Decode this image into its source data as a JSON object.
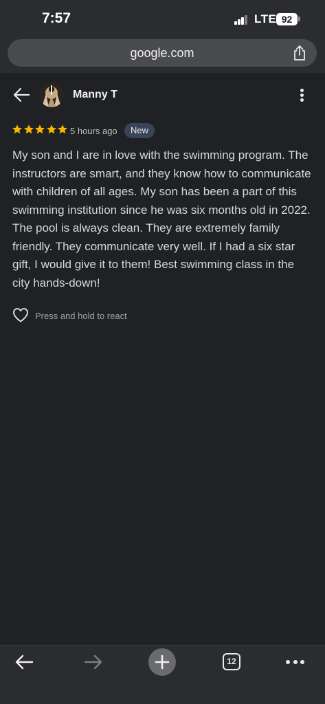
{
  "status_bar": {
    "time": "7:57",
    "network": "LTE",
    "battery": "92"
  },
  "browser": {
    "url": "google.com"
  },
  "review": {
    "reviewer_name": "Manny T",
    "rating": 5,
    "time_ago": "5 hours ago",
    "badge": "New",
    "text": "My son and I are in love with the swimming program. The instructors are smart, and they know how to communicate with children of all ages. My son has been a part of this swimming institution since he was six months old in 2022. The pool is always clean. They are extremely family friendly. They communicate very well. If I had a six star gift, I would give it to them! Best swimming class in the city hands-down!",
    "react_hint": "Press and hold to react"
  },
  "toolbar": {
    "tab_count": "12"
  },
  "icons": {
    "back": "arrow-left-icon",
    "more": "more-vertical-icon",
    "share": "share-icon",
    "heart": "heart-outline-icon",
    "star": "star-icon",
    "forward": "arrow-right-icon",
    "new_tab": "plus-icon",
    "tabs": "tab-switcher-icon",
    "menu": "more-horizontal-icon"
  },
  "colors": {
    "star": "#f6b700",
    "badge_bg": "#394457",
    "background": "#202124"
  }
}
